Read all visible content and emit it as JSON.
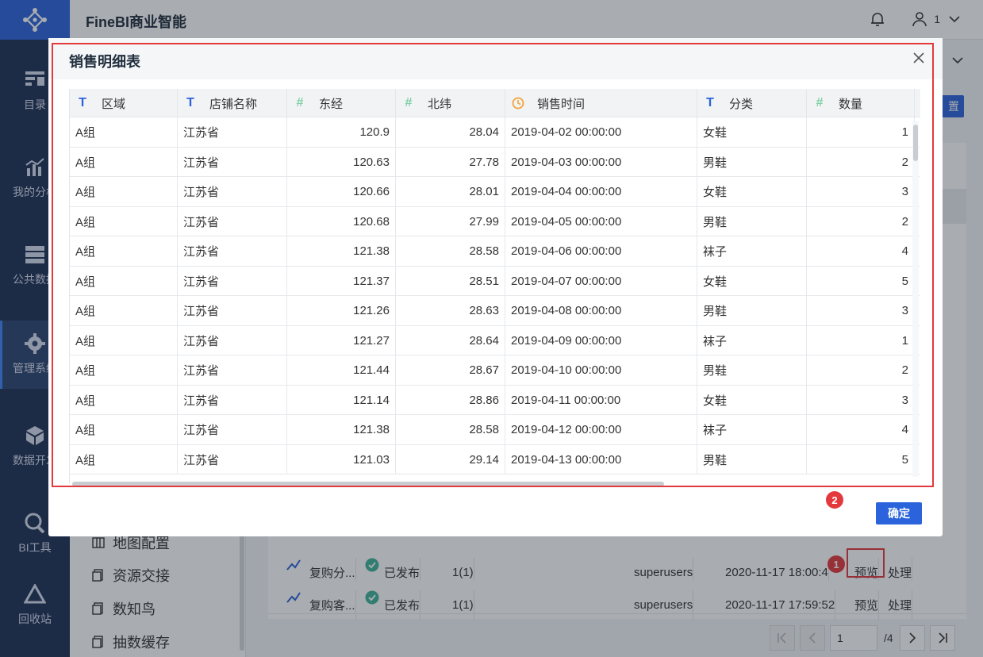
{
  "app": {
    "title": "FineBI商业智能",
    "user": "1"
  },
  "sidebar": {
    "items": [
      {
        "label": "目录",
        "icon": "catalog-icon"
      },
      {
        "label": "我的分析",
        "icon": "chart-bars-icon"
      },
      {
        "label": "公共数据",
        "icon": "database-icon"
      },
      {
        "label": "管理系统",
        "icon": "gear-icon"
      },
      {
        "label": "数据开发",
        "icon": "cube-icon"
      },
      {
        "label": "BI工具",
        "icon": "tool-icon"
      },
      {
        "label": "回收站",
        "icon": "recycle-icon"
      }
    ]
  },
  "submenu": {
    "items": [
      {
        "label": "地图配置"
      },
      {
        "label": "资源交接"
      },
      {
        "label": "数知鸟"
      },
      {
        "label": "抽数缓存"
      }
    ]
  },
  "background": {
    "partial_button": "置",
    "rows": [
      {
        "name": "复购分...",
        "status": "已发布",
        "count": "1(1)",
        "owner": "superusers",
        "time": "2020-11-17 18:00:4",
        "preview": "预览",
        "handle": "处理"
      },
      {
        "name": "复购客...",
        "status": "已发布",
        "count": "1(1)",
        "owner": "superusers",
        "time": "2020-11-17 17:59:52",
        "preview": "预览",
        "handle": "处理"
      }
    ],
    "pagination": {
      "current": "1",
      "total": "/4"
    }
  },
  "annotations": {
    "badge1": "1",
    "badge2": "2"
  },
  "modal": {
    "title": "销售明细表",
    "ok": "确定",
    "columns": [
      {
        "label": "区域",
        "type": "text"
      },
      {
        "label": "店铺名称",
        "type": "text"
      },
      {
        "label": "东经",
        "type": "number"
      },
      {
        "label": "北纬",
        "type": "number"
      },
      {
        "label": "销售时间",
        "type": "time"
      },
      {
        "label": "分类",
        "type": "text"
      },
      {
        "label": "数量",
        "type": "number"
      }
    ],
    "rows": [
      [
        "A组",
        "江苏省",
        "120.9",
        "28.04",
        "2019-04-02 00:00:00",
        "女鞋",
        "1"
      ],
      [
        "A组",
        "江苏省",
        "120.63",
        "27.78",
        "2019-04-03 00:00:00",
        "男鞋",
        "2"
      ],
      [
        "A组",
        "江苏省",
        "120.66",
        "28.01",
        "2019-04-04 00:00:00",
        "女鞋",
        "3"
      ],
      [
        "A组",
        "江苏省",
        "120.68",
        "27.99",
        "2019-04-05 00:00:00",
        "男鞋",
        "2"
      ],
      [
        "A组",
        "江苏省",
        "121.38",
        "28.58",
        "2019-04-06 00:00:00",
        "袜子",
        "4"
      ],
      [
        "A组",
        "江苏省",
        "121.37",
        "28.51",
        "2019-04-07 00:00:00",
        "女鞋",
        "5"
      ],
      [
        "A组",
        "江苏省",
        "121.26",
        "28.63",
        "2019-04-08 00:00:00",
        "男鞋",
        "3"
      ],
      [
        "A组",
        "江苏省",
        "121.27",
        "28.64",
        "2019-04-09 00:00:00",
        "袜子",
        "1"
      ],
      [
        "A组",
        "江苏省",
        "121.44",
        "28.67",
        "2019-04-10 00:00:00",
        "男鞋",
        "2"
      ],
      [
        "A组",
        "江苏省",
        "121.14",
        "28.86",
        "2019-04-11 00:00:00",
        "女鞋",
        "3"
      ],
      [
        "A组",
        "江苏省",
        "121.38",
        "28.58",
        "2019-04-12 00:00:00",
        "袜子",
        "4"
      ],
      [
        "A组",
        "江苏省",
        "121.03",
        "29.14",
        "2019-04-13 00:00:00",
        "男鞋",
        "5"
      ]
    ]
  }
}
